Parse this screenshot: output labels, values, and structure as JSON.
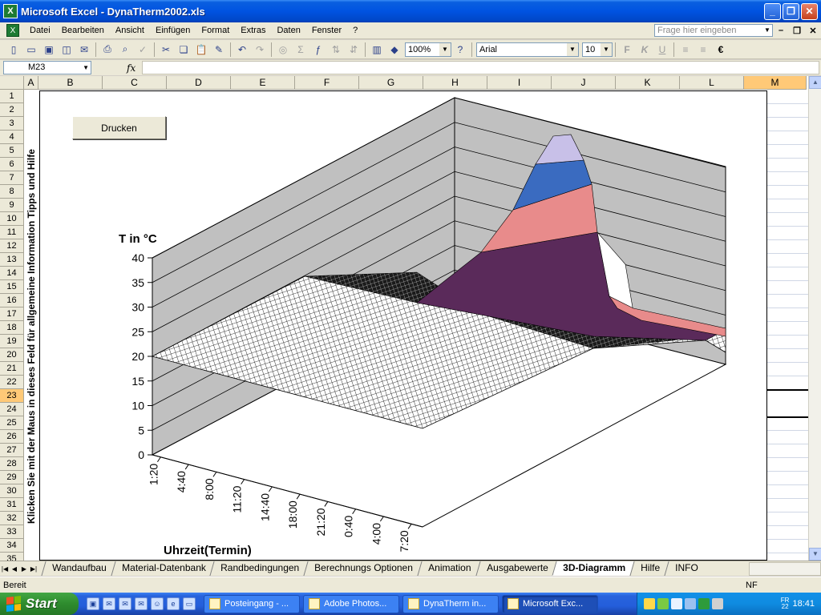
{
  "window": {
    "title": "Microsoft Excel - DynaTherm2002.xls"
  },
  "menu": {
    "items": [
      "Datei",
      "Bearbeiten",
      "Ansicht",
      "Einfügen",
      "Format",
      "Extras",
      "Daten",
      "Fenster",
      "?"
    ],
    "help_placeholder": "Frage hier eingeben"
  },
  "toolbar": {
    "zoom": "100%",
    "font": "Arial",
    "font_size": "10"
  },
  "formula": {
    "cell_ref": "M23",
    "fx": "fx"
  },
  "columns": [
    "A",
    "B",
    "C",
    "D",
    "E",
    "F",
    "G",
    "H",
    "I",
    "J",
    "K",
    "L",
    "M"
  ],
  "selected_column": "M",
  "rows": [
    "1",
    "2",
    "3",
    "4",
    "5",
    "6",
    "7",
    "8",
    "9",
    "10",
    "11",
    "12",
    "13",
    "14",
    "15",
    "16",
    "17",
    "18",
    "19",
    "20",
    "21",
    "22",
    "23",
    "24",
    "25",
    "26",
    "27",
    "28",
    "29",
    "30",
    "31",
    "32",
    "33",
    "34",
    "35"
  ],
  "selected_row": "23",
  "sheet": {
    "vertical_hint": "Klicken Sie mit der Maus in dieses Feld für allgemeine Information Tipps und Hilfe",
    "print_button": "Drucken"
  },
  "chart_data": {
    "type": "surface-3d",
    "zlabel": "T in °C",
    "xlabel": "Uhrzeit(Termin)",
    "z_ticks": [
      "0",
      "5",
      "10",
      "15",
      "20",
      "25",
      "30",
      "35",
      "40"
    ],
    "zlim": [
      0,
      40
    ],
    "x_ticks": [
      "1:20",
      "4:40",
      "8:00",
      "11:20",
      "14:40",
      "18:00",
      "21:20",
      "0:40",
      "4:00",
      "7:20"
    ],
    "band_colors": [
      "#ffffff",
      "#5a2a5a",
      "#e88b8b",
      "#3a6bc0",
      "#c8c0e8"
    ]
  },
  "tabs": [
    "Wandaufbau",
    "Material-Datenbank",
    "Randbedingungen",
    "Berechnungs Optionen",
    "Animation",
    "Ausgabewerte",
    "3D-Diagramm",
    "Hilfe",
    "INFO"
  ],
  "active_tab": "3D-Diagramm",
  "status": {
    "left": "Bereit",
    "right": "NF"
  },
  "taskbar": {
    "start": "Start",
    "tasks": [
      "Posteingang - ...",
      "Adobe Photos...",
      "DynaTherm in...",
      "Microsoft Exc..."
    ],
    "active_task": "Microsoft Exc...",
    "clock": "18:41",
    "day": "FR",
    "date": "22"
  }
}
